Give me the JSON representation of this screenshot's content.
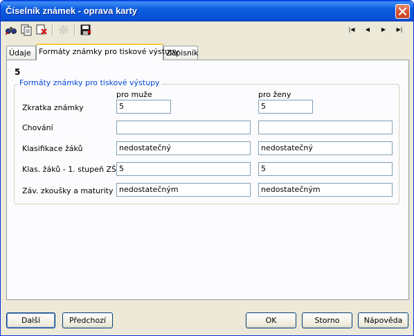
{
  "window": {
    "title": "Číselník známek - oprava karty"
  },
  "toolbar": {
    "icons": [
      "binoculars-search-icon",
      "copy-icon",
      "delete-record-icon",
      "disabled-action-icon",
      "save-icon"
    ],
    "nav": {
      "first": "|◀",
      "prev": "◀",
      "next": "▶",
      "last": "▶|"
    }
  },
  "tabs": [
    {
      "label": "Údaje"
    },
    {
      "label": "Formáty známky pro tiskové výstupy"
    },
    {
      "label": "Zápisník"
    }
  ],
  "panel": {
    "card_number": "5",
    "group_title": "Formáty známky pro tiskové výstupy",
    "col_male": "pro muže",
    "col_female": "pro ženy",
    "rows": [
      {
        "label": "Zkratka známky",
        "male": "5",
        "female": "5"
      },
      {
        "label": "Chování",
        "male": "",
        "female": ""
      },
      {
        "label": "Klasifikace žáků",
        "male": "nedostatečný",
        "female": "nedostatečný"
      },
      {
        "label": "Klas. žáků - 1. stupeň ZŠ",
        "male": "5",
        "female": "5"
      },
      {
        "label": "Záv. zkoušky a maturity",
        "male": "nedostatečným",
        "female": "nedostatečným"
      }
    ]
  },
  "buttons": {
    "next": "Další",
    "previous": "Předchozí",
    "ok": "OK",
    "cancel": "Storno",
    "help": "Nápověda"
  }
}
